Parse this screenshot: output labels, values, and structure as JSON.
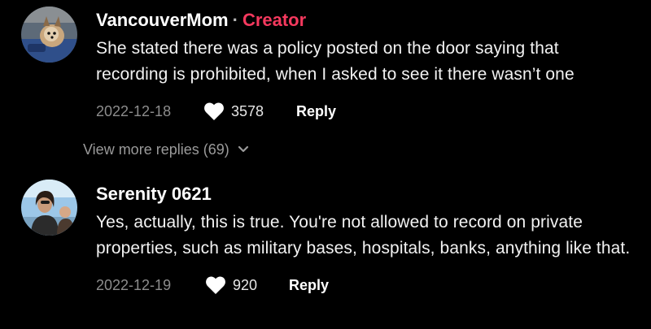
{
  "comments": [
    {
      "username": "VancouverMom",
      "separator": "·",
      "badge": "Creator",
      "text": "She stated there was a policy posted on the door saying that recording is prohibited, when I asked to see it there wasn’t one",
      "date": "2022-12-18",
      "likes": "3578",
      "reply_label": "Reply",
      "avatar_icon": "dog-photo-avatar"
    },
    {
      "username": "Serenity 0621",
      "text": "Yes, actually, this is true. You're not allowed to record on private properties, such as military bases, hospitals, banks, anything like that.",
      "date": "2022-12-19",
      "likes": "920",
      "reply_label": "Reply",
      "avatar_icon": "person-photo-avatar"
    }
  ],
  "view_more": {
    "label": "View more replies (69)",
    "icon": "chevron-down-icon"
  },
  "colors": {
    "background": "#000000",
    "creator_badge": "#f5395e",
    "secondary_text": "#8c8c8c"
  }
}
